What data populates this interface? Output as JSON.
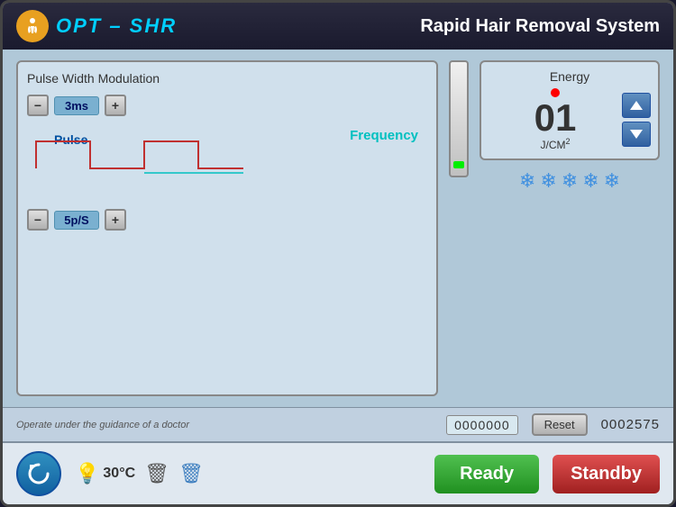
{
  "header": {
    "title": "Rapid Hair Removal System",
    "logo_text": "OPT – SHR",
    "logo_icon": "🏃"
  },
  "left_panel": {
    "title": "Pulse Width Modulation",
    "pulse_label": "Pulse",
    "frequency_label": "Frequency",
    "pulse_value": "3ms",
    "frequency_value": "5p/S",
    "minus_label": "−",
    "plus_label": "+"
  },
  "right_panel": {
    "energy_title": "Energy",
    "energy_value": "01",
    "energy_unit": "J/CM²",
    "snowflakes_count": 5
  },
  "info_bar": {
    "guidance_text": "Operate under the guidance of a doctor",
    "counter_value": "0000000",
    "reset_label": "Reset",
    "total_counter": "0002575"
  },
  "footer": {
    "temp_label": "30°C",
    "ready_label": "Ready",
    "standby_label": "Standby"
  }
}
